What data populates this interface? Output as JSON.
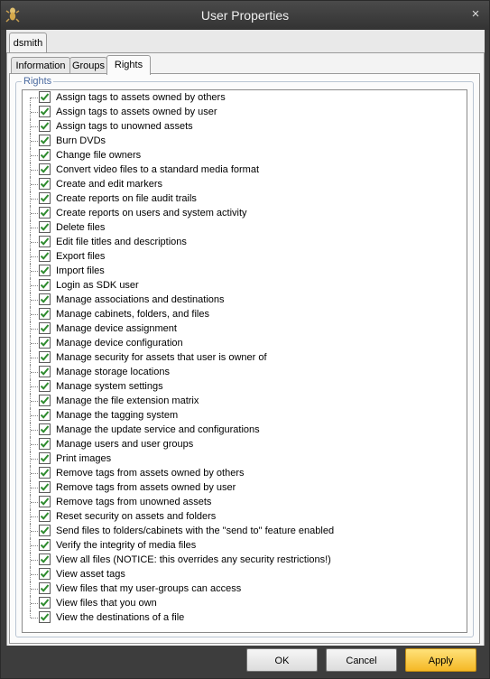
{
  "window": {
    "title": "User Properties",
    "app_icon": "gecko-icon",
    "close_glyph": "×"
  },
  "user_tab": {
    "label": "dsmith"
  },
  "tabs": [
    {
      "label": "Information",
      "active": false
    },
    {
      "label": "Groups",
      "active": false
    },
    {
      "label": "Rights",
      "active": true
    }
  ],
  "rights": {
    "title": "Rights",
    "items": [
      {
        "label": "Assign tags to assets owned by others",
        "checked": true
      },
      {
        "label": "Assign tags to assets owned by user",
        "checked": true
      },
      {
        "label": "Assign tags to unowned assets",
        "checked": true
      },
      {
        "label": "Burn DVDs",
        "checked": true
      },
      {
        "label": "Change file owners",
        "checked": true
      },
      {
        "label": "Convert video files to a standard media format",
        "checked": true
      },
      {
        "label": "Create and edit markers",
        "checked": true
      },
      {
        "label": "Create reports on file audit trails",
        "checked": true
      },
      {
        "label": "Create reports on users and system activity",
        "checked": true
      },
      {
        "label": "Delete files",
        "checked": true
      },
      {
        "label": "Edit file titles and descriptions",
        "checked": true
      },
      {
        "label": "Export files",
        "checked": true
      },
      {
        "label": "Import files",
        "checked": true
      },
      {
        "label": "Login as SDK user",
        "checked": true
      },
      {
        "label": "Manage associations and destinations",
        "checked": true
      },
      {
        "label": "Manage cabinets, folders, and files",
        "checked": true
      },
      {
        "label": "Manage device assignment",
        "checked": true
      },
      {
        "label": "Manage device configuration",
        "checked": true
      },
      {
        "label": "Manage security for assets that user is owner of",
        "checked": true
      },
      {
        "label": "Manage storage locations",
        "checked": true
      },
      {
        "label": "Manage system settings",
        "checked": true
      },
      {
        "label": "Manage the file extension matrix",
        "checked": true
      },
      {
        "label": "Manage the tagging system",
        "checked": true
      },
      {
        "label": "Manage the update service and configurations",
        "checked": true
      },
      {
        "label": "Manage users and user groups",
        "checked": true
      },
      {
        "label": "Print images",
        "checked": true
      },
      {
        "label": "Remove tags from assets owned by others",
        "checked": true
      },
      {
        "label": "Remove tags from assets owned by user",
        "checked": true
      },
      {
        "label": "Remove tags from unowned assets",
        "checked": true
      },
      {
        "label": "Reset security on assets and folders",
        "checked": true
      },
      {
        "label": "Send files to folders/cabinets with the \"send to\" feature enabled",
        "checked": true
      },
      {
        "label": "Verify the integrity of media files",
        "checked": true
      },
      {
        "label": "View all files (NOTICE: this overrides any security restrictions!)",
        "checked": true
      },
      {
        "label": "View asset tags",
        "checked": true
      },
      {
        "label": "View files that my user-groups can access",
        "checked": true
      },
      {
        "label": "View files that you own",
        "checked": true
      },
      {
        "label": "View the destinations of a file",
        "checked": true
      }
    ]
  },
  "buttons": {
    "ok": "OK",
    "cancel": "Cancel",
    "apply": "Apply"
  },
  "colors": {
    "check": "#2e8b2e",
    "apply_button": "#f5b825",
    "group_title": "#4a6aa0"
  }
}
